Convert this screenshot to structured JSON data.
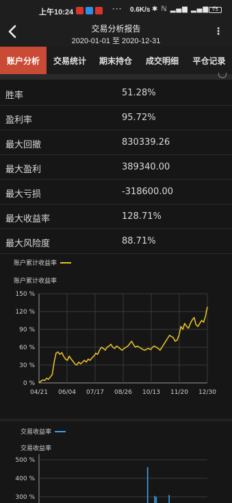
{
  "status_bar": {
    "time": "上午10:24",
    "more_dots": "···",
    "speed": "0.6K/s",
    "icons": "✱ ℕ ▂▄▆ ▂▄▆ ◠",
    "battery": "75"
  },
  "header": {
    "title": "交易分析报告",
    "subtitle": "2020-01-01 至 2020-12-31",
    "more": "⋮"
  },
  "tabs": [
    {
      "label": "账户分析",
      "active": true
    },
    {
      "label": "交易统计",
      "active": false
    },
    {
      "label": "期末持仓",
      "active": false
    },
    {
      "label": "成交明细",
      "active": false
    },
    {
      "label": "平仓记录",
      "active": false
    }
  ],
  "stats": [
    {
      "label": "胜率",
      "value": "51.28%"
    },
    {
      "label": "盈利率",
      "value": "95.72%"
    },
    {
      "label": "最大回撤",
      "value": "830339.26"
    },
    {
      "label": "最大盈利",
      "value": "389340.00"
    },
    {
      "label": "最大亏损",
      "value": "-318600.00"
    },
    {
      "label": "最大收益率",
      "value": "128.71%"
    },
    {
      "label": "最大风险度",
      "value": "88.71%"
    }
  ],
  "colors": {
    "accent": "#c94b35",
    "line_yellow": "#e5c02a",
    "line_blue": "#3fa0e8",
    "background": "#161616"
  },
  "chart_data": [
    {
      "type": "line",
      "legend": "账户累计收益率",
      "title": "账户累计收益率",
      "x_ticks": [
        "04/21",
        "06/04",
        "07/17",
        "08/26",
        "10/13",
        "11/20",
        "12/30"
      ],
      "y_ticks": [
        "0 %",
        "30 %",
        "60 %",
        "90 %",
        "120 %",
        "150 %"
      ],
      "ylim": [
        0,
        150
      ],
      "series": [
        {
          "name": "账户累计收益率",
          "values": [
            0,
            3,
            5,
            4,
            8,
            6,
            10,
            14,
            35,
            50,
            52,
            48,
            51,
            45,
            40,
            38,
            45,
            40,
            36,
            32,
            30,
            35,
            32,
            35,
            38,
            35,
            40,
            38,
            42,
            45,
            50,
            48,
            55,
            60,
            58,
            55,
            60,
            62,
            65,
            60,
            58,
            62,
            60,
            57,
            55,
            58,
            60,
            62,
            66,
            70,
            64,
            60,
            62,
            60,
            58,
            56,
            55,
            57,
            58,
            56,
            60,
            62,
            60,
            58,
            55,
            60,
            65,
            70,
            75,
            80,
            78,
            76,
            70,
            72,
            80,
            95,
            90,
            100,
            95,
            92,
            100,
            106,
            110,
            98,
            95,
            100,
            105,
            102,
            112,
            128
          ]
        }
      ]
    },
    {
      "type": "bar",
      "legend": "交易收益率",
      "title": "交易收益率",
      "y_ticks": [
        "300 %",
        "400 %",
        "500 %"
      ],
      "ylim": [
        0,
        500
      ],
      "values": [
        0,
        0,
        0,
        0,
        0,
        0,
        0,
        0,
        0,
        460,
        0,
        0,
        0,
        0,
        305,
        300,
        0,
        0,
        0,
        0,
        0,
        0,
        0,
        0,
        310,
        0,
        0,
        0
      ]
    }
  ]
}
